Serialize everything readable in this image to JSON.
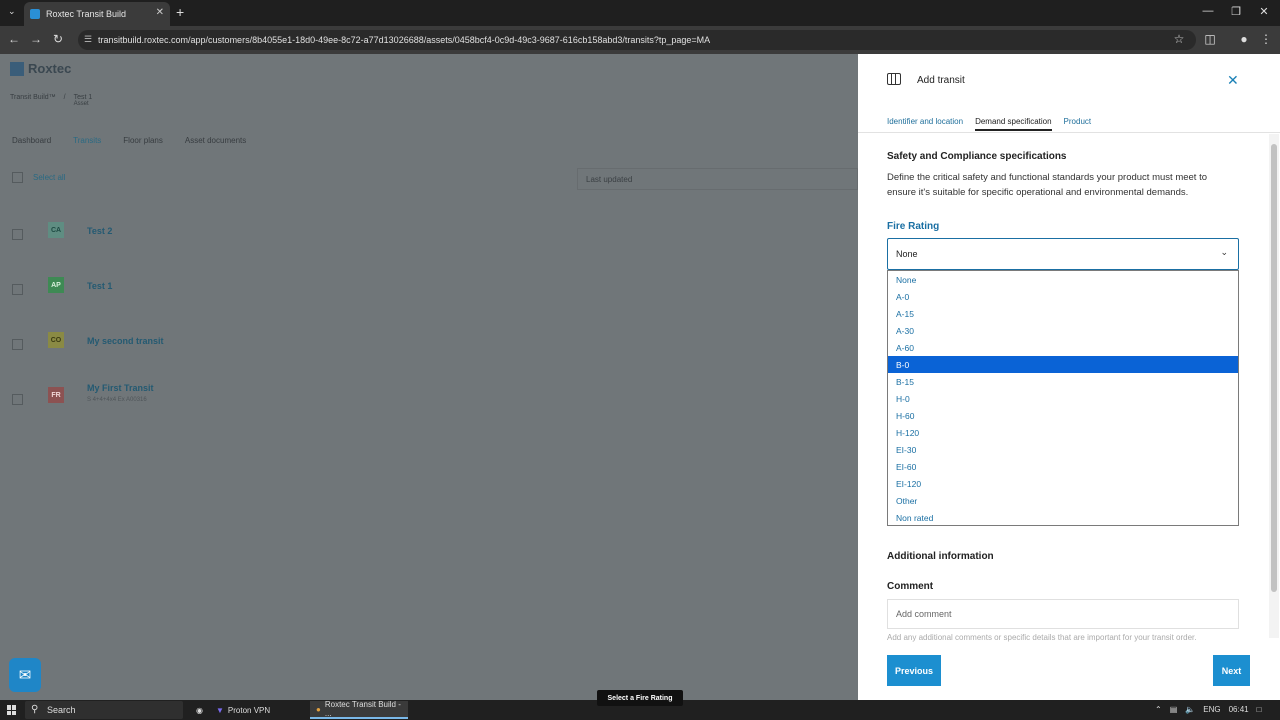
{
  "browser": {
    "tab_title": "Roxtec Transit Build",
    "url": "transitbuild.roxtec.com/app/customers/8b4055e1-18d0-49ee-8c72-a77d13026688/assets/0458bcf4-0c9d-49c3-9687-616cb158abd3/transits?tp_page=MA"
  },
  "app": {
    "logo_text": "Roxtec",
    "breadcrumb": {
      "root": "Transit Build™",
      "current": "Test 1",
      "current_sub": "Asset"
    },
    "nav_tabs": [
      "Dashboard",
      "Transits",
      "Floor plans",
      "Asset documents"
    ],
    "select_all": "Select all",
    "column_last_updated": "Last updated",
    "rows": [
      {
        "initials": "CA",
        "name": "Test 2",
        "sub": "",
        "badge_bg": "#5f8d82",
        "badge_fg": "#1f4b44"
      },
      {
        "initials": "AP",
        "name": "Test 1",
        "sub": "",
        "badge_bg": "#3e8a54",
        "badge_fg": "#d8f0dc"
      },
      {
        "initials": "CO",
        "name": "My second transit",
        "sub": "",
        "badge_bg": "#8a8a44",
        "badge_fg": "#3a3a12"
      },
      {
        "initials": "FR",
        "name": "My First Transit",
        "sub": "S 4+4+4x4 Ex A00316",
        "badge_bg": "#8c5252",
        "badge_fg": "#f2d8d8"
      }
    ]
  },
  "panel": {
    "title": "Add transit",
    "steps": [
      "Identifier and location",
      "Demand specification",
      "Product"
    ],
    "section_title": "Safety and Compliance specifications",
    "section_desc": "Define the critical safety and functional standards your product must meet to ensure it's suitable for specific operational and environmental demands.",
    "fire_label": "Fire Rating",
    "fire_selected": "None",
    "fire_options": [
      "None",
      "A-0",
      "A-15",
      "A-30",
      "A-60",
      "B-0",
      "B-15",
      "H-0",
      "H-60",
      "H-120",
      "EI-30",
      "EI-60",
      "EI-120",
      "Other",
      "Non rated"
    ],
    "highlighted_option": "B-0",
    "additional_info": "Additional information",
    "comment_label": "Comment",
    "comment_placeholder": "Add comment",
    "comment_hint": "Add any additional comments or specific details that are important for your transit order.",
    "prev": "Previous",
    "next": "Next"
  },
  "taskbar": {
    "search": "Search",
    "apps": [
      "Proton VPN",
      "Roxtec Transit Build - ..."
    ],
    "tooltip": "Select a Fire Rating",
    "lang": "ENG",
    "time": "06:41"
  }
}
